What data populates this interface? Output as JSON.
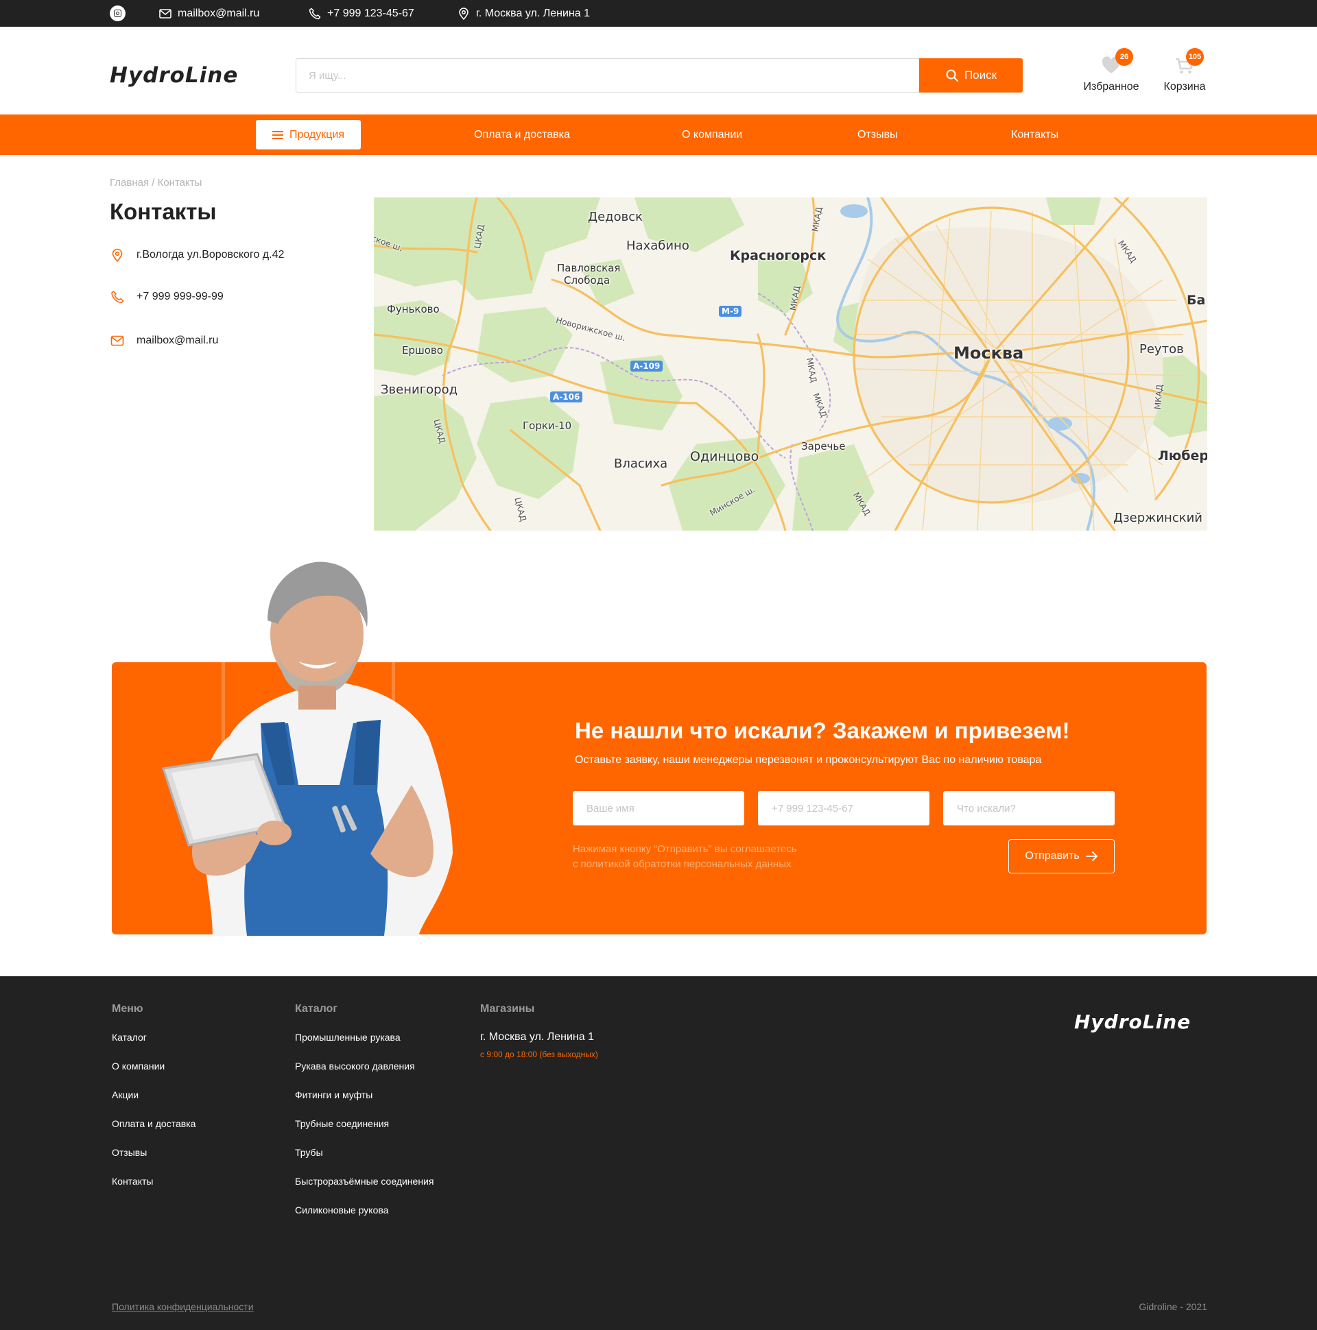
{
  "topbar": {
    "email": "mailbox@mail.ru",
    "phone": "+7 999 123-45-67",
    "address": "г. Москва ул. Ленина 1"
  },
  "header": {
    "logo": "HydroLine",
    "search_placeholder": "Я ищу...",
    "search_button": "Поиск",
    "favorites": {
      "label": "Избранное",
      "count": "26"
    },
    "cart": {
      "label": "Корзина",
      "count": "105"
    }
  },
  "nav": {
    "products": "Продукция",
    "items": [
      "Оплата и доставка",
      "О компании",
      "Отзывы",
      "Контакты"
    ]
  },
  "breadcrumb": "Главная / Контакты",
  "page_title": "Контакты",
  "contacts": {
    "address": "г.Вологда ул.Воровского д.42",
    "phone": "+7 999 999-99-99",
    "email": "mailbox@mail.ru"
  },
  "map": {
    "labels": [
      "Дедовск",
      "Нахабино",
      "Красногорск",
      "Павловская",
      "Слобода",
      "Фуньково",
      "Ершово",
      "Звенигород",
      "Горки-10",
      "Власиха",
      "Одинцово",
      "Заречье",
      "Москва",
      "Реутов",
      "Ба",
      "Любер",
      "Дзержинский"
    ],
    "shields": [
      "М-9",
      "А-109",
      "А-106"
    ],
    "roads": [
      "ЦКАД",
      "ЦКАД",
      "ЦКАД",
      "МКАД",
      "МКАД",
      "МКАД",
      "МКАД",
      "МКАД",
      "МКАД",
      "МКАД",
      "Новорижское ш.",
      "Минское ш.",
      "ское ш."
    ]
  },
  "order": {
    "title": "Не нашли что искали? Закажем и привезем!",
    "subtitle": "Оставьте заявку, наши менеджеры перезвонят и проконсультируют Вас по наличию товара",
    "name_placeholder": "Ваше имя",
    "phone_placeholder": "+7 999 123-45-67",
    "query_placeholder": "Что искали?",
    "note_line1": "Нажимая кнопку “Отправить” вы соглашаетесь",
    "note_line2": "с политикой обратотки персональных данных",
    "button": "Отправить"
  },
  "footer": {
    "menu_title": "Меню",
    "menu": [
      "Каталог",
      "О компании",
      "Акции",
      "Оплата и доставка",
      "Отзывы",
      "Контакты"
    ],
    "catalog_title": "Каталог",
    "catalog": [
      "Промышленные рукава",
      "Рукава высокого давления",
      "Фитинги и муфты",
      "Трубные соединения",
      "Трубы",
      "Быстроразъёмные соединения",
      "Силиконовые рукова"
    ],
    "shops_title": "Магазины",
    "shop_address": "г. Москва ул. Ленина 1",
    "shop_hours": "с 9:00 до 18:00 (без выходных)",
    "logo": "HydroLine",
    "policy": "Политика конфиденциальности",
    "copyright": "Gidroline - 2021"
  },
  "colors": {
    "accent": "#ff6600",
    "dark": "#222222"
  }
}
